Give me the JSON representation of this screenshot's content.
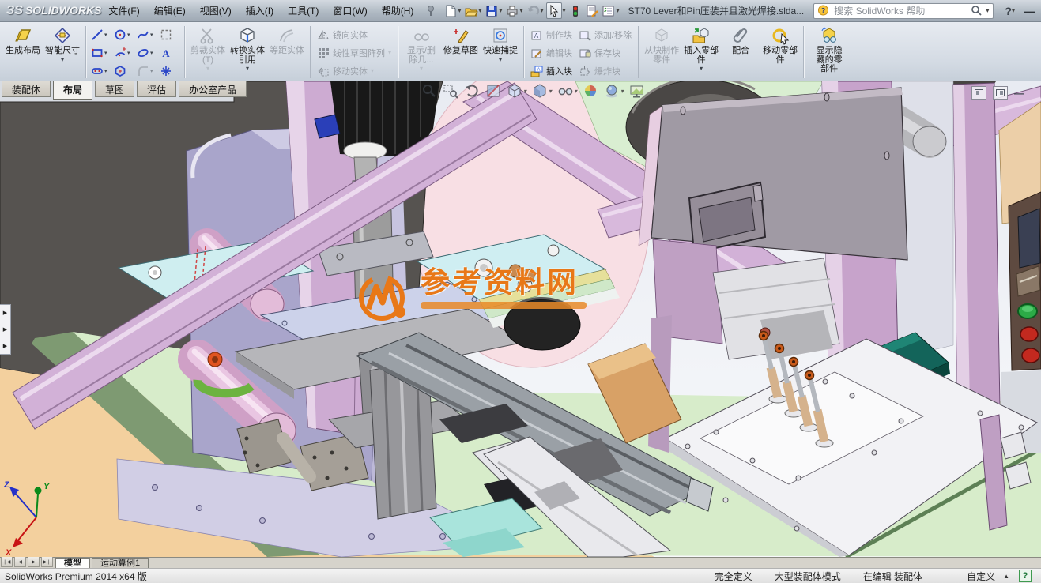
{
  "title_bar": {
    "logo_mark": "ЗS",
    "logo_text": "SOLIDWORKS",
    "menus": [
      "文件(F)",
      "编辑(E)",
      "视图(V)",
      "插入(I)",
      "工具(T)",
      "窗口(W)",
      "帮助(H)"
    ],
    "quick_toolbar_icons": [
      "new-document",
      "open",
      "save",
      "print",
      "undo",
      "select",
      "rebuild-traffic-light",
      "file-properties",
      "options"
    ],
    "document_title": "ST70 Lever和Pin压装并且激光焊接.slda...",
    "search_placeholder": "搜索 SolidWorks 帮助",
    "help_glyph": "?",
    "minimize_glyph": "—"
  },
  "ribbon": {
    "generate_layout": {
      "label": "生成布局"
    },
    "smart_dimension": {
      "label": "智能尺寸"
    },
    "trim_entities": {
      "label": "剪裁实体(T)"
    },
    "convert_entities": {
      "label": "转换实体引用"
    },
    "offset_entities": {
      "label": "等距实体"
    },
    "mirror_entities": {
      "label": "镜向实体"
    },
    "linear_pattern": {
      "label": "线性草图阵列"
    },
    "move_entities": {
      "label": "移动实体"
    },
    "display_delete_relations": {
      "label": "显示/删除几..."
    },
    "repair_sketch": {
      "label": "修复草图"
    },
    "quick_snaps": {
      "label": "快速捕捉"
    },
    "make_block": {
      "label": "制作块"
    },
    "edit_block": {
      "label": "编辑块"
    },
    "insert_block": {
      "label": "插入块"
    },
    "add_remove": {
      "label": "添加/移除"
    },
    "save_block": {
      "label": "保存块"
    },
    "explode_block": {
      "label": "爆炸块"
    },
    "make_part_from_block": {
      "label": "从块制作零件"
    },
    "insert_components": {
      "label": "插入零部件"
    },
    "mate": {
      "label": "配合"
    },
    "move_component": {
      "label": "移动零部件"
    },
    "show_hidden_components": {
      "label": "显示隐藏的零部件"
    }
  },
  "command_tabs": {
    "items": [
      {
        "label": "装配体"
      },
      {
        "label": "布局"
      },
      {
        "label": "草图"
      },
      {
        "label": "评估"
      },
      {
        "label": "办公室产品"
      }
    ],
    "active": "布局"
  },
  "viewport": {
    "hud_icons": [
      "zoom-to-fit",
      "zoom-to-area",
      "previous-view",
      "section-view",
      "view-orientation",
      "display-style",
      "hide-show-items",
      "edit-appearance",
      "apply-scene",
      "view-settings"
    ],
    "window_control_icons": [
      "restore-pane",
      "restore-window",
      "minimize-window"
    ],
    "watermark": {
      "text": "参考资料网"
    },
    "triad": {
      "x_label": "X",
      "y_label": "Y",
      "z_label": "Z"
    },
    "colors": {
      "frame_purple": "#cdabd2",
      "machine_lavender": "#a9a5cb",
      "roller_pink": "#d9aed0",
      "floor_tan": "#f3d09e",
      "plate_green": "#d7ecca",
      "panel_mauve": "#a09aa4",
      "box_teal": "#13645a",
      "watermark_orange": "#e87818",
      "button_green": "#2cab47",
      "button_red": "#c3291f"
    }
  },
  "bottom_tabs": {
    "items": [
      {
        "label": "模型"
      },
      {
        "label": "运动算例1"
      }
    ],
    "active": "模型"
  },
  "status_bar": {
    "left": "SolidWorks Premium 2014 x64 版",
    "fields": [
      "完全定义",
      "大型装配体模式",
      "在编辑 装配体"
    ],
    "custom_label": "自定义",
    "help_glyph": "?"
  }
}
